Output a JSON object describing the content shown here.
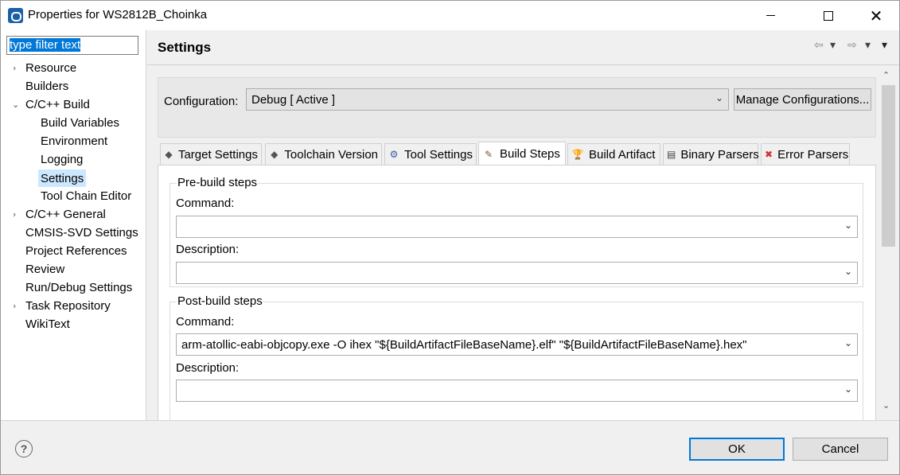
{
  "window": {
    "title": "Properties for WS2812B_Choinka",
    "icons": {
      "app": "app-logo-icon",
      "minimize": "minimize-icon",
      "maximize": "maximize-icon",
      "close": "close-icon"
    },
    "close_glyph": "✕"
  },
  "sidebar": {
    "filter_value": "type filter text",
    "items": [
      {
        "label": "Resource",
        "expandable": true,
        "expanded": false,
        "level": 0
      },
      {
        "label": "Builders",
        "expandable": false,
        "level": 0
      },
      {
        "label": "C/C++ Build",
        "expandable": true,
        "expanded": true,
        "level": 0
      },
      {
        "label": "Build Variables",
        "expandable": false,
        "level": 1
      },
      {
        "label": "Environment",
        "expandable": false,
        "level": 1
      },
      {
        "label": "Logging",
        "expandable": false,
        "level": 1
      },
      {
        "label": "Settings",
        "expandable": false,
        "level": 1,
        "selected": true
      },
      {
        "label": "Tool Chain Editor",
        "expandable": false,
        "level": 1
      },
      {
        "label": "C/C++ General",
        "expandable": true,
        "expanded": false,
        "level": 0
      },
      {
        "label": "CMSIS-SVD Settings",
        "expandable": false,
        "level": 0
      },
      {
        "label": "Project References",
        "expandable": false,
        "level": 0
      },
      {
        "label": "Review",
        "expandable": false,
        "level": 0
      },
      {
        "label": "Run/Debug Settings",
        "expandable": false,
        "level": 0
      },
      {
        "label": "Task Repository",
        "expandable": true,
        "expanded": false,
        "level": 0
      },
      {
        "label": "WikiText",
        "expandable": false,
        "level": 0
      }
    ]
  },
  "main": {
    "title": "Settings",
    "nav": {
      "back_glyph": "⇦",
      "forward_glyph": "⇨",
      "dropdown_glyph": "▾"
    },
    "configuration": {
      "label": "Configuration:",
      "value": "Debug  [ Active ]",
      "manage_button": "Manage Configurations..."
    },
    "tabs": [
      {
        "label": "Target Settings",
        "icon": "target-settings-icon",
        "glyph": "◆",
        "active": false
      },
      {
        "label": "Toolchain Version",
        "icon": "toolchain-icon",
        "glyph": "◆",
        "active": false
      },
      {
        "label": "Tool Settings",
        "icon": "tool-settings-icon",
        "glyph": "⚙",
        "active": false
      },
      {
        "label": "Build Steps",
        "icon": "build-steps-icon",
        "glyph": "✎",
        "active": true
      },
      {
        "label": "Build Artifact",
        "icon": "build-artifact-icon",
        "glyph": "🏆",
        "active": false
      },
      {
        "label": "Binary Parsers",
        "icon": "binary-parsers-icon",
        "glyph": "▤",
        "active": false
      },
      {
        "label": "Error Parsers",
        "icon": "error-parsers-icon",
        "glyph": "✖",
        "active": false
      }
    ],
    "pre_build": {
      "title": "Pre-build steps",
      "command_label": "Command:",
      "command_value": "",
      "description_label": "Description:",
      "description_value": ""
    },
    "post_build": {
      "title": "Post-build steps",
      "command_label": "Command:",
      "command_value": "arm-atollic-eabi-objcopy.exe -O ihex \"${BuildArtifactFileBaseName}.elf\" \"${BuildArtifactFileBaseName}.hex\"",
      "description_label": "Description:",
      "description_value": ""
    }
  },
  "footer": {
    "help_glyph": "?",
    "ok_button": "OK",
    "cancel_button": "Cancel"
  },
  "colors": {
    "selection": "#cce8ff",
    "filter_highlight": "#0078d7",
    "ok_border": "#0078d7"
  }
}
